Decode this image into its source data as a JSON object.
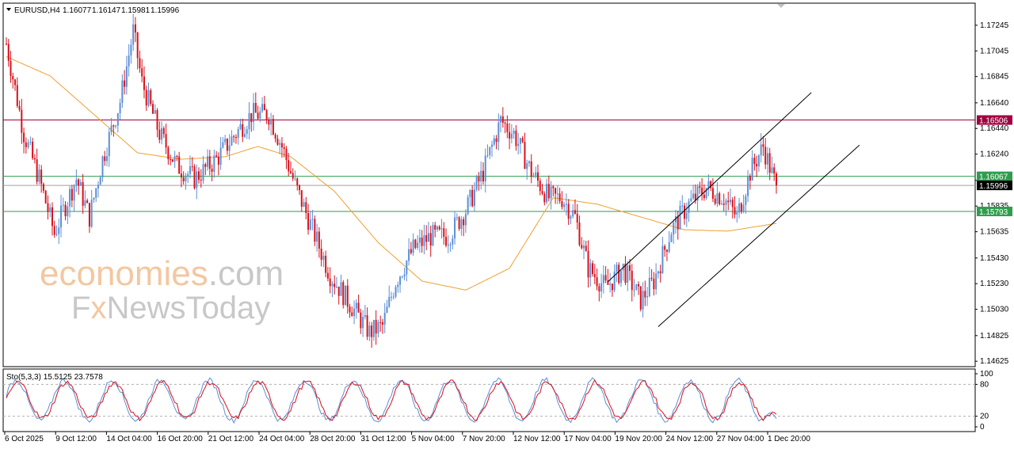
{
  "header": {
    "symbol": "EURUSD,H4",
    "open": "1.16077",
    "high": "1.16147",
    "low": "1.15981",
    "close": "1.15996"
  },
  "watermark": {
    "line1_colored": "economies",
    "line1_gray": ".com",
    "line2_a": "F",
    "line2_x": "x",
    "line2_b": "NewsToday"
  },
  "colors": {
    "bull": "#5b8fd6",
    "bear": "#d9101a",
    "ma": "#f0a030",
    "resistance": "#a00040",
    "support": "#2e9e4e",
    "stoch_main": "#5b8fd6",
    "stoch_signal": "#d9101a",
    "watermark_orange": "#f3c7a0",
    "watermark_gray": "#c8c8c8"
  },
  "chart_data": [
    {
      "type": "candlestick",
      "title": "EURUSD,H4",
      "ylim": [
        1.1462,
        1.1738
      ],
      "yticks": [
        "1.17245",
        "1.17045",
        "1.16845",
        "1.16640",
        "1.16440",
        "1.16240",
        "1.16035",
        "1.15835",
        "1.15635",
        "1.15430",
        "1.15230",
        "1.15030",
        "1.14825",
        "1.14625"
      ],
      "xticks": [
        "6 Oct 2025",
        "9 Oct 12:00",
        "14 Oct 04:00",
        "16 Oct 20:00",
        "21 Oct 12:00",
        "24 Oct 04:00",
        "28 Oct 20:00",
        "31 Oct 12:00",
        "5 Nov 04:00",
        "7 Nov 20:00",
        "12 Nov 12:00",
        "17 Nov 04:00",
        "19 Nov 20:00",
        "24 Nov 12:00",
        "27 Nov 04:00",
        "1 Dec 20:00"
      ],
      "price_keypoints": [
        [
          0,
          1.171
        ],
        [
          8,
          1.164
        ],
        [
          15,
          1.1605
        ],
        [
          22,
          1.1562
        ],
        [
          26,
          1.158
        ],
        [
          32,
          1.1605
        ],
        [
          38,
          1.1575
        ],
        [
          44,
          1.162
        ],
        [
          52,
          1.1665
        ],
        [
          58,
          1.172
        ],
        [
          62,
          1.168
        ],
        [
          70,
          1.164
        ],
        [
          78,
          1.1615
        ],
        [
          86,
          1.1605
        ],
        [
          96,
          1.162
        ],
        [
          104,
          1.1638
        ],
        [
          112,
          1.1655
        ],
        [
          120,
          1.1655
        ],
        [
          126,
          1.163
        ],
        [
          132,
          1.16
        ],
        [
          140,
          1.1565
        ],
        [
          148,
          1.153
        ],
        [
          158,
          1.1505
        ],
        [
          166,
          1.1485
        ],
        [
          172,
          1.149
        ],
        [
          178,
          1.1525
        ],
        [
          186,
          1.155
        ],
        [
          194,
          1.156
        ],
        [
          202,
          1.156
        ],
        [
          210,
          1.158
        ],
        [
          218,
          1.161
        ],
        [
          226,
          1.165
        ],
        [
          232,
          1.164
        ],
        [
          240,
          1.161
        ],
        [
          248,
          1.159
        ],
        [
          254,
          1.159
        ],
        [
          260,
          1.1575
        ],
        [
          266,
          1.1535
        ],
        [
          274,
          1.152
        ],
        [
          282,
          1.1535
        ],
        [
          290,
          1.151
        ],
        [
          296,
          1.1525
        ],
        [
          304,
          1.1565
        ],
        [
          312,
          1.1585
        ],
        [
          320,
          1.1598
        ],
        [
          328,
          1.159
        ],
        [
          334,
          1.1575
        ],
        [
          340,
          1.161
        ],
        [
          346,
          1.163
        ],
        [
          352,
          1.1598
        ]
      ],
      "current_price": "1.15996",
      "horizontal_levels": [
        {
          "label": "1.16506",
          "value": 1.16506,
          "kind": "resistance"
        },
        {
          "label": "1.16067",
          "value": 1.16067,
          "kind": "support"
        },
        {
          "label": "1.15793",
          "value": 1.15793,
          "kind": "support"
        }
      ],
      "moving_average_keypoints": [
        [
          0,
          1.17
        ],
        [
          20,
          1.1685
        ],
        [
          40,
          1.1655
        ],
        [
          60,
          1.1625
        ],
        [
          80,
          1.162
        ],
        [
          100,
          1.1622
        ],
        [
          115,
          1.163
        ],
        [
          130,
          1.1622
        ],
        [
          150,
          1.1595
        ],
        [
          170,
          1.1555
        ],
        [
          190,
          1.1525
        ],
        [
          210,
          1.1518
        ],
        [
          230,
          1.1535
        ],
        [
          250,
          1.159
        ],
        [
          270,
          1.1585
        ],
        [
          290,
          1.1575
        ],
        [
          310,
          1.1565
        ],
        [
          330,
          1.1564
        ],
        [
          352,
          1.157
        ]
      ],
      "channel": {
        "upper": [
          [
            275,
            1.15245
          ],
          [
            368,
            1.1672
          ]
        ],
        "lower": [
          [
            298,
            1.14895
          ],
          [
            390,
            1.1631
          ]
        ]
      }
    },
    {
      "type": "line",
      "title": "Sto(5,3,3) 15.5125 23.7578",
      "indicator": "Sto(5,3,3)",
      "main_value": "15.5125",
      "signal_value": "23.7578",
      "ylim": [
        0,
        100
      ],
      "yticks": [
        "100",
        "80",
        "20",
        "0"
      ],
      "levels": [
        80,
        20
      ],
      "series": [
        {
          "name": "main",
          "wave": {
            "period": 22,
            "amplitude": 38,
            "center": 50,
            "phase": 0.3,
            "last": 15.5125
          }
        },
        {
          "name": "signal",
          "wave": {
            "period": 22,
            "amplitude": 34,
            "center": 50,
            "phase": 0.0,
            "last": 23.7578
          }
        }
      ]
    }
  ]
}
